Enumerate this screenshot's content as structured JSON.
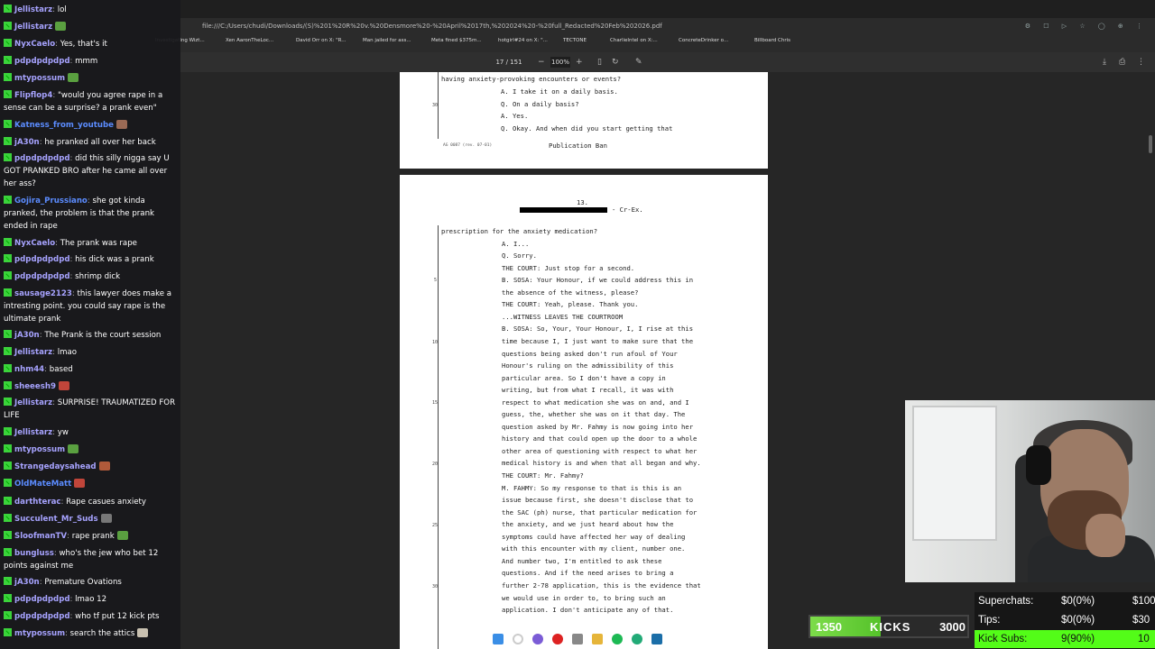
{
  "browser": {
    "url": "file:///C:/Users/chudi/Downloads/(S)%201%20R%20v.%20Densmore%20-%20April%2017th,%202024%20-%20full_Redacted%20Feb%202026.pdf",
    "bookmarks": [
      "Investigating Wizt...",
      "Xen AaronTheLoc...",
      "David Orr on X: \"R...",
      "Man jailed for ass...",
      "Meta fined $375m...",
      "hotgirl#24 on X: \"...",
      "TECTONE",
      "CharlieIntel on X:...",
      "ConcreteDrinker o...",
      "Billboard Chris"
    ]
  },
  "pdf_toolbar": {
    "page_current": "17",
    "page_total": "/ 151",
    "zoom": "100%"
  },
  "pdf": {
    "page1": {
      "lines": [
        "having anxiety-provoking encounters or events?",
        "A.  I take it on a daily basis.",
        "Q.  On a daily basis?",
        "A.  Yes.",
        "Q.  Okay.  And when did you start getting that"
      ],
      "line_number": "30",
      "footer_left": "AG 0087 (rev. 07-01)",
      "footer_center": "Publication Ban"
    },
    "page2": {
      "page_number": "13.",
      "header_suffix": "- Cr-Ex.",
      "line_numbers": [
        "5",
        "10",
        "15",
        "20",
        "25",
        "30"
      ],
      "lines": [
        "prescription for the anxiety medication?",
        "A.  I...",
        "Q.  Sorry.",
        "THE COURT:  Just stop for a second.",
        "B. SOSA:  Your Honour, if we could address this in",
        "the absence of the witness, please?",
        "THE COURT:  Yeah, please.  Thank you.",
        "...WITNESS LEAVES THE COURTROOM",
        "B. SOSA:  So, Your, Your Honour, I, I rise at this",
        "time because I, I just want to make sure that the",
        "questions being asked don't run afoul of Your",
        "Honour's ruling on the admissibility of this",
        "particular area.  So I don't have a copy in",
        "writing, but from what I recall, it was with",
        "respect to what medication she was on and, and I",
        "guess, the, whether she was on it that day.  The",
        "question asked by Mr. Fahmy is now going into her",
        "history and that could open up the door to a whole",
        "other area of questioning with respect to what her",
        "medical history is and when that all began and why.",
        "THE COURT:  Mr. Fahmy?",
        "M. FAHMY:  So my response to that is this is an",
        "issue because first, she doesn't disclose that to",
        "the SAC (ph) nurse, that particular medication for",
        "the anxiety, and we just heard about how the",
        "symptoms could have affected her way of dealing",
        "with this encounter with my client, number one.",
        "And number two, I'm entitled to ask these",
        "questions.  And if the need arises to bring a",
        "further 2-78 application, this is the evidence that",
        "we would use in order to, to bring such an",
        "application.  I don't anticipate any of that."
      ]
    }
  },
  "chat": {
    "messages": [
      {
        "user": "Jellistarz",
        "text": "lol",
        "color": "#a7a3ff",
        "emote": ""
      },
      {
        "user": "Jellistarz",
        "text": "",
        "color": "#a7a3ff",
        "emote": "#5aa040"
      },
      {
        "user": "NyxCaelo",
        "text": "Yes, that's it",
        "color": "#a7a3ff",
        "emote": ""
      },
      {
        "user": "pdpdpdpdpd",
        "text": "mmm",
        "color": "#a7a3ff",
        "emote": ""
      },
      {
        "user": "mtypossum",
        "text": "",
        "color": "#a7a3ff",
        "emote": "#5aa040"
      },
      {
        "user": "Flipflop4",
        "text": "\"would you agree rape in a sense can be a surprise? a prank even\"",
        "color": "#a7a3ff",
        "emote": ""
      },
      {
        "user": "Katness_from_youtube",
        "text": "",
        "color": "#5b8cff",
        "emote": "#9a6a55"
      },
      {
        "user": "jA30n",
        "text": "he pranked all over her back",
        "color": "#a7a3ff",
        "emote": ""
      },
      {
        "user": "pdpdpdpdpd",
        "text": "did this silly nigga say U GOT PRANKED BRO after he came all over her ass?",
        "color": "#a7a3ff",
        "emote": ""
      },
      {
        "user": "Gojira_Prussiano",
        "text": "she got kinda pranked, the problem is that the prank ended in rape",
        "color": "#5b8cff",
        "emote": ""
      },
      {
        "user": "NyxCaelo",
        "text": "The prank was rape",
        "color": "#a7a3ff",
        "emote": ""
      },
      {
        "user": "pdpdpdpdpd",
        "text": "his dick was a prank",
        "color": "#a7a3ff",
        "emote": ""
      },
      {
        "user": "pdpdpdpdpd",
        "text": "shrimp dick",
        "color": "#a7a3ff",
        "emote": ""
      },
      {
        "user": "sausage2123",
        "text": "this lawyer does make a intresting point. you could say rape is the ultimate prank",
        "color": "#a7a3ff",
        "emote": ""
      },
      {
        "user": "jA30n",
        "text": "The Prank is the court session",
        "color": "#a7a3ff",
        "emote": ""
      },
      {
        "user": "Jellistarz",
        "text": "lmao",
        "color": "#a7a3ff",
        "emote": ""
      },
      {
        "user": "nhm44",
        "text": "based",
        "color": "#a7a3ff",
        "emote": ""
      },
      {
        "user": "sheeesh9",
        "text": "",
        "color": "#a7a3ff",
        "emote": "#c0453a"
      },
      {
        "user": "Jellistarz",
        "text": "SURPRISE! TRAUMATIZED FOR LIFE",
        "color": "#a7a3ff",
        "emote": ""
      },
      {
        "user": "Jellistarz",
        "text": "yw",
        "color": "#a7a3ff",
        "emote": ""
      },
      {
        "user": "mtypossum",
        "text": "",
        "color": "#a7a3ff",
        "emote": "#5aa040"
      },
      {
        "user": "Strangedaysahead",
        "text": "",
        "color": "#a7a3ff",
        "emote": "#b05a3a"
      },
      {
        "user": "OldMateMatt",
        "text": "",
        "color": "#5b8cff",
        "emote": "#c0453a"
      },
      {
        "user": "darthterac",
        "text": "Rape casues anxiety",
        "color": "#a7a3ff",
        "emote": ""
      },
      {
        "user": "Succulent_Mr_Suds",
        "text": "",
        "color": "#a7a3ff",
        "emote": "#777777"
      },
      {
        "user": "SloofmanTV",
        "text": "rape prank",
        "color": "#a7a3ff",
        "emote": "#5aa040"
      },
      {
        "user": "bungluss",
        "text": "who's the jew who bet 12 points against me",
        "color": "#a7a3ff",
        "emote": ""
      },
      {
        "user": "jA30n",
        "text": "Premature Ovations",
        "color": "#a7a3ff",
        "emote": ""
      },
      {
        "user": "pdpdpdpdpd",
        "text": "lmao 12",
        "color": "#a7a3ff",
        "emote": ""
      },
      {
        "user": "pdpdpdpdpd",
        "text": "who tf put 12 kick pts",
        "color": "#a7a3ff",
        "emote": ""
      },
      {
        "user": "mtypossum",
        "text": "search the attics",
        "color": "#a7a3ff",
        "emote": "#c8c0b0"
      }
    ]
  },
  "stats": {
    "superchats_label": "Superchats:",
    "superchats_value": "$0(0%)",
    "superchats_goal": "$100",
    "tips_label": "Tips:",
    "tips_value": "$0(0%)",
    "tips_goal": "$30",
    "kicksubs_label": "Kick Subs:",
    "kicksubs_value": "9(90%)",
    "kicksubs_goal": "10",
    "kicksubs_color": "#53fc18"
  },
  "kicks_goal": {
    "current": "1350",
    "label": "KICKS",
    "goal": "3000",
    "progress": 0.45
  }
}
